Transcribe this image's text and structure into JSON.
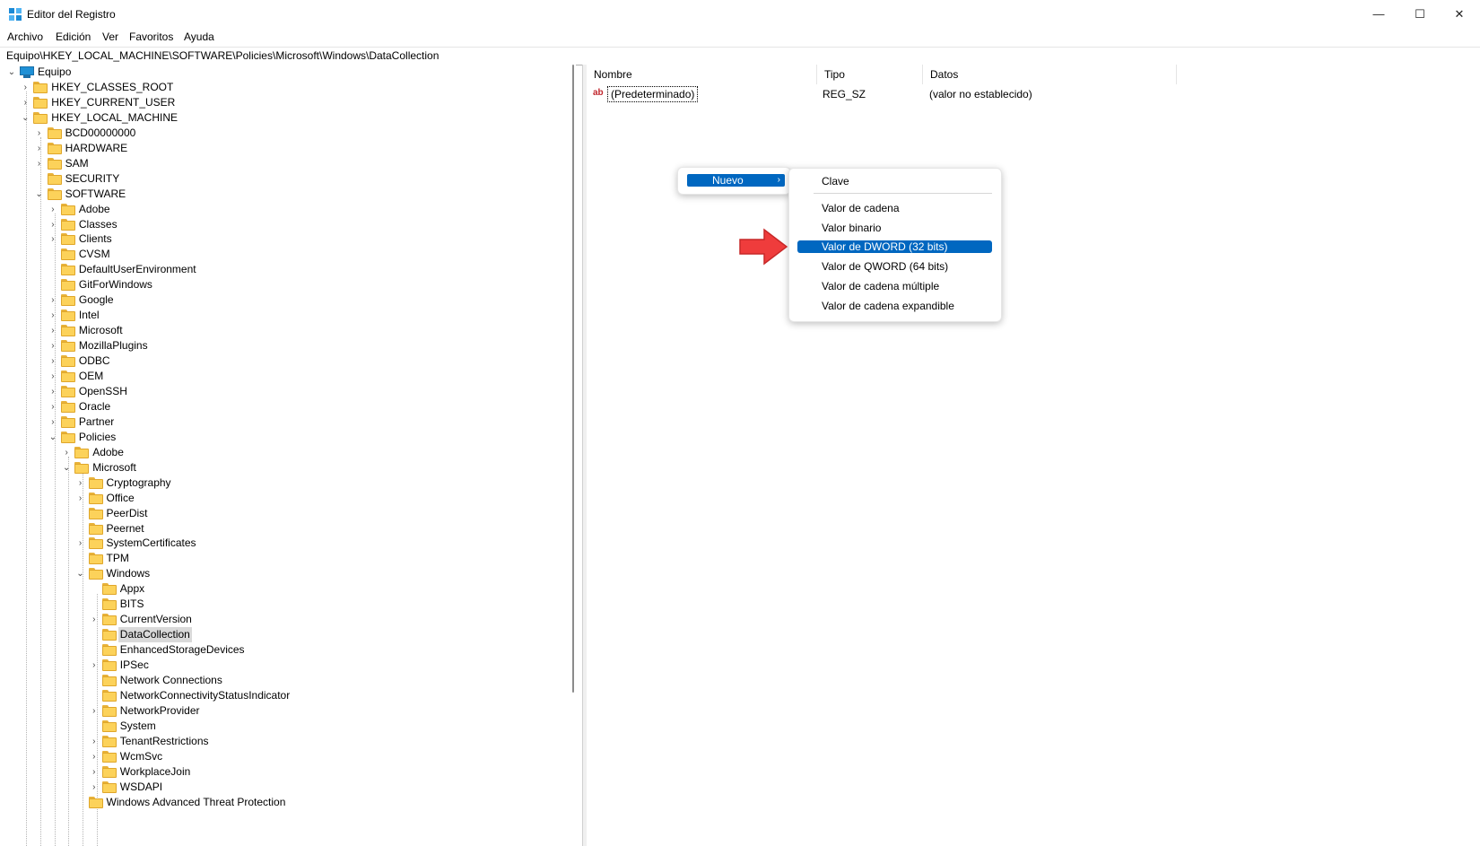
{
  "window": {
    "title": "Editor del Registro",
    "minimize": "—",
    "maximize": "☐",
    "close": "✕"
  },
  "menu": [
    "Archivo",
    "Edición",
    "Ver",
    "Favoritos",
    "Ayuda"
  ],
  "address": "Equipo\\HKEY_LOCAL_MACHINE\\SOFTWARE\\Policies\\Microsoft\\Windows\\DataCollection",
  "tree": {
    "root": "Equipo",
    "items": [
      "HKEY_CLASSES_ROOT",
      "HKEY_CURRENT_USER",
      "HKEY_LOCAL_MACHINE",
      "BCD00000000",
      "HARDWARE",
      "SAM",
      "SECURITY",
      "SOFTWARE",
      "Adobe",
      "Classes",
      "Clients",
      "CVSM",
      "DefaultUserEnvironment",
      "GitForWindows",
      "Google",
      "Intel",
      "Microsoft",
      "MozillaPlugins",
      "ODBC",
      "OEM",
      "OpenSSH",
      "Oracle",
      "Partner",
      "Policies",
      "Adobe",
      "Microsoft",
      "Cryptography",
      "Office",
      "PeerDist",
      "Peernet",
      "SystemCertificates",
      "TPM",
      "Windows",
      "Appx",
      "BITS",
      "CurrentVersion",
      "DataCollection",
      "EnhancedStorageDevices",
      "IPSec",
      "Network Connections",
      "NetworkConnectivityStatusIndicator",
      "NetworkProvider",
      "System",
      "TenantRestrictions",
      "WcmSvc",
      "WorkplaceJoin",
      "WSDAPI",
      "Windows Advanced Threat Protection"
    ]
  },
  "list": {
    "columns": [
      "Nombre",
      "Tipo",
      "Datos"
    ],
    "rows": [
      {
        "name": "(Predeterminado)",
        "type": "REG_SZ",
        "data": "(valor no establecido)",
        "icon": "ab"
      }
    ]
  },
  "context_menu": {
    "parent": "Nuevo",
    "submenu": [
      "Clave",
      "Valor de cadena",
      "Valor binario",
      "Valor de DWORD (32 bits)",
      "Valor de QWORD (64 bits)",
      "Valor de cadena múltiple",
      "Valor de cadena expandible"
    ],
    "highlighted": "Valor de DWORD (32 bits)"
  },
  "colors": {
    "highlight": "#0067c0",
    "folder": "#fcd25a",
    "arrow": "#ef3c3c"
  }
}
